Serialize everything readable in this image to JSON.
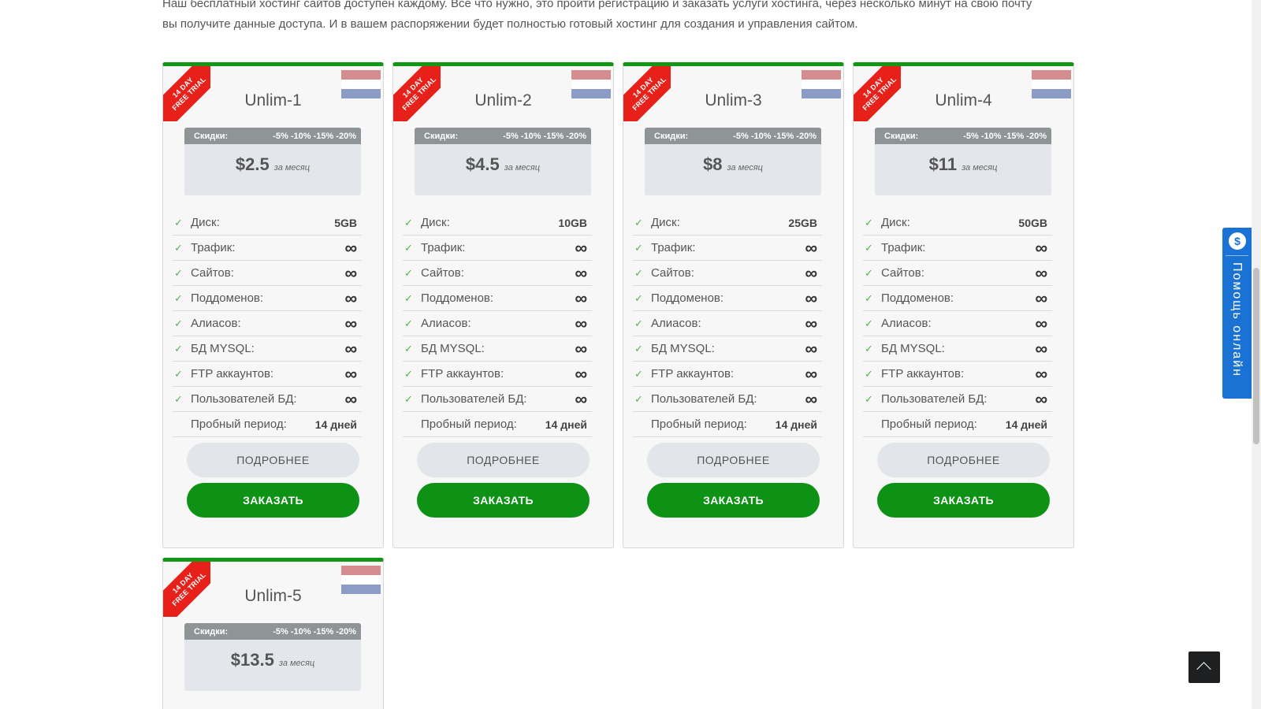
{
  "intro": {
    "line1": "Наш бесплатный хостинг сайтов доступен каждому. Все что нужно, это пройти регистрацию и заказать услуги хостинга, через несколько минут на свою почту",
    "line2": "вы получите данные доступа. И в вашем распоряжении будет полностью готовый хостинг для создания и управления сайтом."
  },
  "ribbon": {
    "line1": "14 DAY",
    "line2": "FREE TRIAL"
  },
  "discount": {
    "label": "Скидки:",
    "values": "-5% -10% -15% -20%"
  },
  "per_month": "за месяц",
  "feature_labels": {
    "disk": "Диск:",
    "traffic": "Трафик:",
    "sites": "Сайтов:",
    "subdomains": "Поддоменов:",
    "aliases": "Алиасов:",
    "mysql": "БД MYSQL:",
    "ftp": "FTP аккаунтов:",
    "dbusers": "Пользователей БД:",
    "trial": "Пробный период:"
  },
  "infinity": "∞",
  "trial_value": "14 дней",
  "buttons": {
    "more": "ПОДРОБНЕЕ",
    "order": "ЗАКАЗАТЬ"
  },
  "plans": [
    {
      "name": "Unlim-1",
      "price": "$2.5",
      "disk": "5GB"
    },
    {
      "name": "Unlim-2",
      "price": "$4.5",
      "disk": "10GB"
    },
    {
      "name": "Unlim-3",
      "price": "$8",
      "disk": "25GB"
    },
    {
      "name": "Unlim-4",
      "price": "$11",
      "disk": "50GB"
    },
    {
      "name": "Unlim-5",
      "price": "$13.5",
      "disk": ""
    }
  ],
  "help": {
    "label": "Помощь онлайн",
    "icon": "chat-dollar-icon"
  },
  "colors": {
    "accent_green": "#0e9216",
    "ribbon_red": "#e8201a",
    "help_blue": "#1a73d4"
  }
}
